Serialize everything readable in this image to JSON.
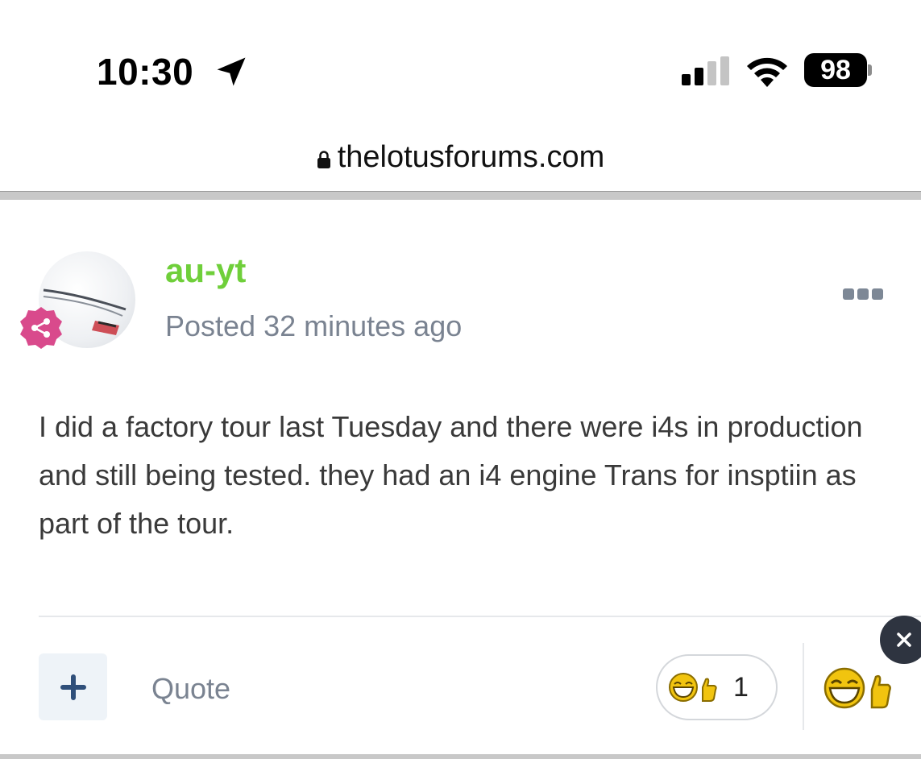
{
  "status_bar": {
    "time": "10:30",
    "battery": "98"
  },
  "browser": {
    "url": "thelotusforums.com"
  },
  "post": {
    "username": "au-yt",
    "posted": "Posted 32 minutes ago",
    "body": "I did a factory tour last Tuesday and there were i4s in production and still being tested. they had an i4 engine Trans for insptiin as part of the tour.",
    "username_color": "#6fcf3a",
    "badge_color": "#d94a8c"
  },
  "actions": {
    "quote_label": "Quote",
    "reaction_count": "1"
  },
  "icons": [
    "location-arrow-icon",
    "signal-icon",
    "wifi-icon",
    "battery-icon",
    "lock-icon",
    "share-badge-icon",
    "more-icon",
    "plus-icon",
    "laugh-thumbs-up-icon",
    "close-icon"
  ]
}
